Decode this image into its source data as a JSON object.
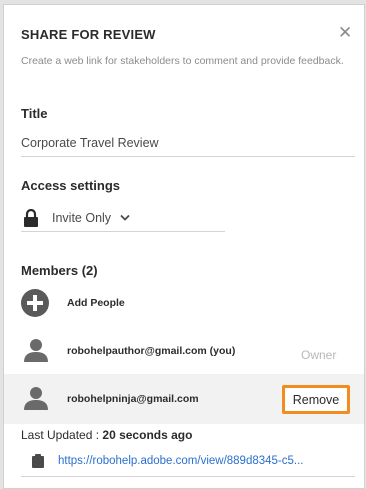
{
  "panel": {
    "title": "SHARE FOR REVIEW",
    "close_glyph": "✕",
    "description": "Create a web link for stakeholders to comment and provide feedback."
  },
  "title_section": {
    "label": "Title",
    "value": "Corporate Travel Review"
  },
  "access": {
    "label": "Access settings",
    "selected": "Invite Only",
    "icon": "lock-icon"
  },
  "members": {
    "label": "Members (2)",
    "add_label": "Add People",
    "list": [
      {
        "email": "robohelpauthor@gmail.com (you)",
        "role": "Owner"
      },
      {
        "email": "robohelpninja@gmail.com",
        "action": "Remove"
      }
    ]
  },
  "footer": {
    "updated_label": "Last Updated :",
    "updated_value": "20 seconds ago",
    "link": "https://robohelp.adobe.com/view/889d8345-c5..."
  },
  "colors": {
    "accent_orange": "#f28c1e",
    "link_blue": "#2a6fcf"
  }
}
